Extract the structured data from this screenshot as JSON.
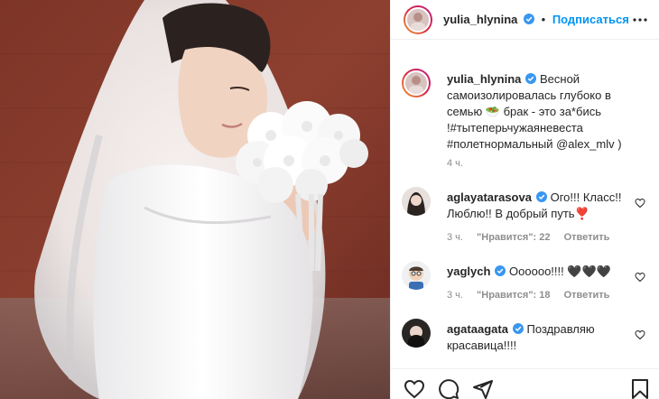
{
  "post": {
    "author": "yulia_hlynina",
    "follow_label": "Подписаться",
    "dot": "•",
    "caption_text": "Весной самоизолировалась глубоко в семью 🥗 брак - это за*бись !#тытеперьчужаяневеста #полетнормальный @alex_mlv )",
    "caption_time": "4 ч."
  },
  "comments": [
    {
      "user": "aglayatarasova",
      "text": "Ого!!! Класс!! Люблю!! В добрый путь❣️",
      "time": "3 ч.",
      "likes": "\"Нравится\": 22",
      "reply": "Ответить"
    },
    {
      "user": "yaglych",
      "text": "Оооооо!!!! 🖤🖤🖤",
      "time": "3 ч.",
      "likes": "\"Нравится\": 18",
      "reply": "Ответить"
    },
    {
      "user": "agataagata",
      "text": "Поздравляю красавица!!!!"
    }
  ],
  "colors": {
    "accent": "#0095f6",
    "verified": "#3897f0",
    "text": "#262626",
    "muted": "#8e8e8e"
  },
  "icons": [
    "verified-icon",
    "more-icon",
    "heart-icon",
    "comment-icon",
    "share-icon",
    "bookmark-icon"
  ]
}
